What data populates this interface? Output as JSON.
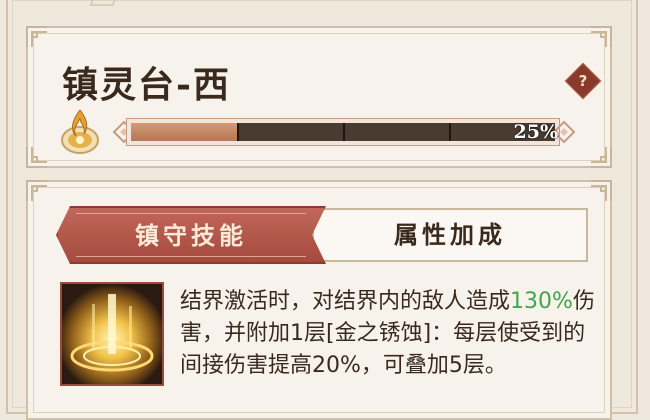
{
  "station": {
    "title": "镇灵台-西",
    "help_label": "?",
    "progress_label": "25%",
    "progress_fraction": 0.25,
    "progress_segments": 4
  },
  "tabs": [
    {
      "label": "镇守技能",
      "active": true
    },
    {
      "label": "属性加成",
      "active": false
    }
  ],
  "skill": {
    "icon": "golden-seal-icon",
    "desc_part1": "结界激活时，对结界内的敌人造成",
    "desc_highlight": "130%",
    "desc_part2": "伤害，并附加1层[金之锈蚀]：每层使受到的间接伤害提高20%，可叠加5层。"
  },
  "colors": {
    "accent": "#a44a3e",
    "highlight": "#3fa64a",
    "bar_fill": "#c28563"
  }
}
